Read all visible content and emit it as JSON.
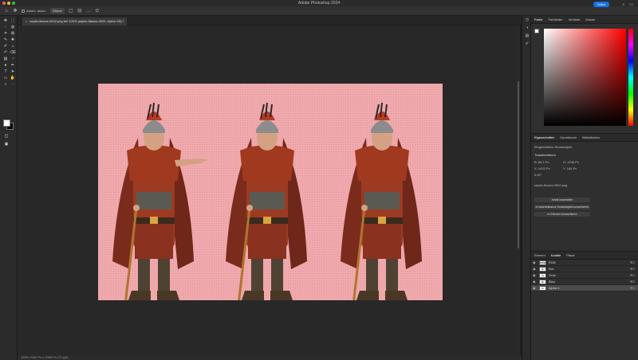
{
  "app": {
    "title": "Adobe Photoshop 2024"
  },
  "options_bar": {
    "auto_select_label": "Autom. ausw.:",
    "layer_select": "Ebene",
    "share_label": "Teilen"
  },
  "document": {
    "tab_label": "septio-flavius-0002.png bei 100% (septio-flavius-0002, Alpha 1/8) *",
    "status": "100%     2160 Px x 1359 Px (72 ppi)"
  },
  "colors": {
    "canvas": "#f0a9ad",
    "accent": "#1473e6"
  },
  "panels": {
    "color_tabs": [
      "Farbe",
      "Farbfelder",
      "Verläufe",
      "Muster"
    ],
    "properties_tabs": [
      "Eigenschaften",
      "Korrekturen",
      "Bibliotheken"
    ],
    "properties": {
      "object_type": "Eingebettetes Smartobjekt",
      "transform_label": "Transformieren",
      "width": "B: 66,1 Px",
      "height": "H: 1236 Px",
      "x": "X: 1422 Px",
      "y": "Y: 184 Px",
      "angle": "0,00°",
      "file": "septio-flavius-0002.png",
      "btn_edit": "Inhalt bearbeiten",
      "btn_convert": "In bearbeitbares Smartobjekt konvertieren",
      "btn_layers": "In Ebenen konvertieren"
    },
    "layers_tabs": [
      "Ebenen",
      "Kanäle",
      "Pfade"
    ],
    "channels": [
      {
        "name": "RGB",
        "shortcut": "⌘2",
        "thumb": "RGB"
      },
      {
        "name": "Rot",
        "shortcut": "⌘3",
        "thumb": "R"
      },
      {
        "name": "Grün",
        "shortcut": "⌘4",
        "thumb": "G"
      },
      {
        "name": "Blau",
        "shortcut": "⌘5",
        "thumb": "B"
      },
      {
        "name": "Alpha 1",
        "shortcut": "⌘6",
        "thumb": "A"
      }
    ]
  }
}
